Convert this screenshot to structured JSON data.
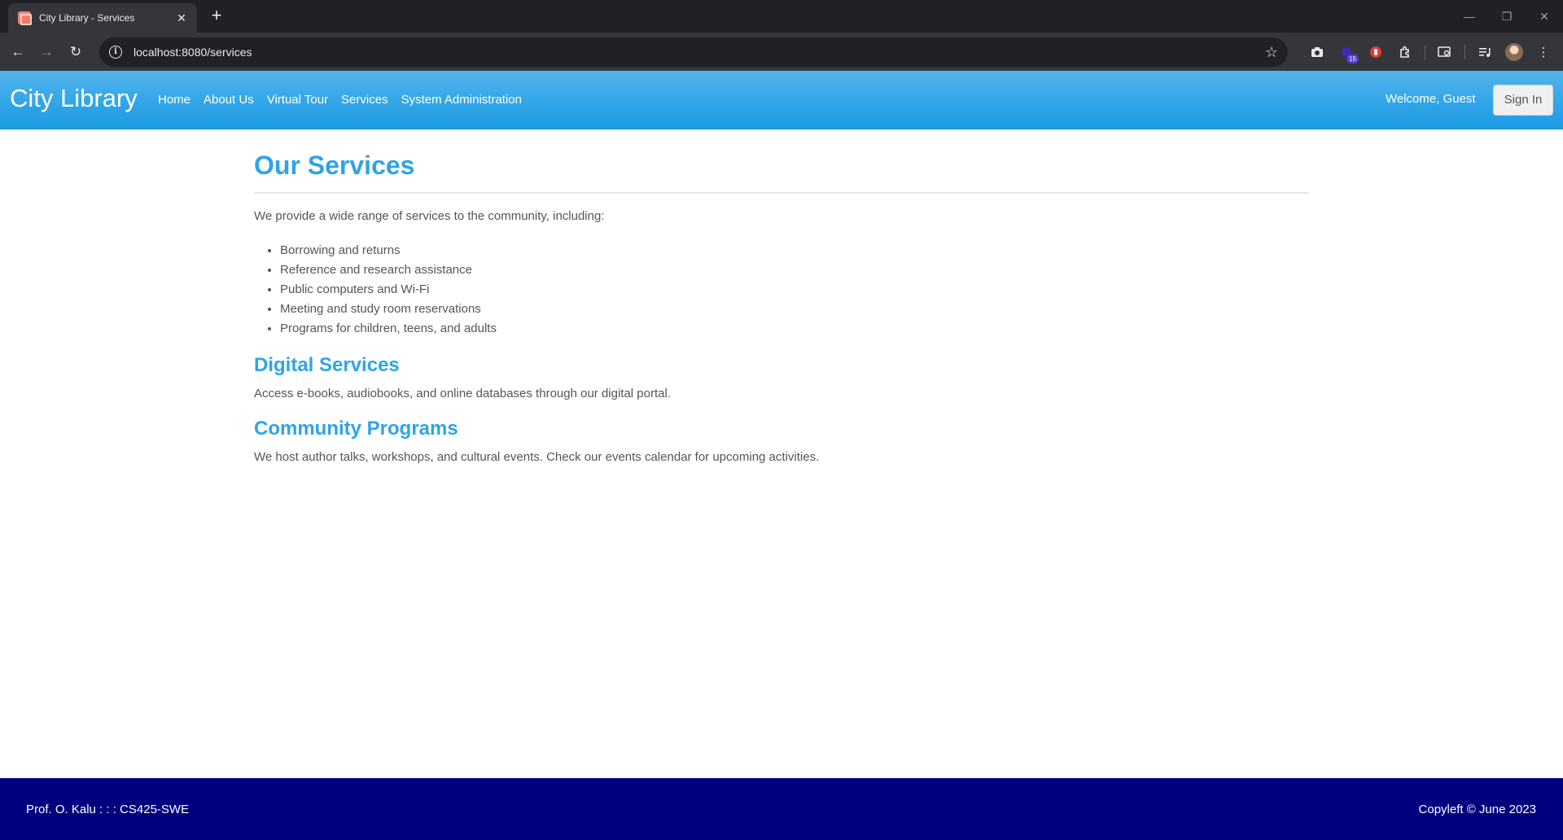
{
  "browser": {
    "tab_title": "City Library - Services",
    "url": "localhost:8080/services",
    "extension_badge": "15"
  },
  "site": {
    "brand": "City Library",
    "nav": [
      "Home",
      "About Us",
      "Virtual Tour",
      "Services",
      "System Administration"
    ],
    "welcome": "Welcome, Guest",
    "signin_label": "Sign In"
  },
  "main": {
    "title": "Our Services",
    "intro": "We provide a wide range of services to the community, including:",
    "services": [
      "Borrowing and returns",
      "Reference and research assistance",
      "Public computers and Wi-Fi",
      "Meeting and study room reservations",
      "Programs for children, teens, and adults"
    ],
    "sections": [
      {
        "title": "Digital Services",
        "text": "Access e-books, audiobooks, and online databases through our digital portal."
      },
      {
        "title": "Community Programs",
        "text": "We host author talks, workshops, and cultural events. Check our events calendar for upcoming activities."
      }
    ]
  },
  "footer": {
    "left": "Prof. O. Kalu : : : CS425-SWE",
    "right": "Copyleft © June 2023"
  },
  "colors": {
    "navbar": "#2fa4e7",
    "heading": "#2fa4e7",
    "footer": "#00007f",
    "body_text": "#555555"
  }
}
